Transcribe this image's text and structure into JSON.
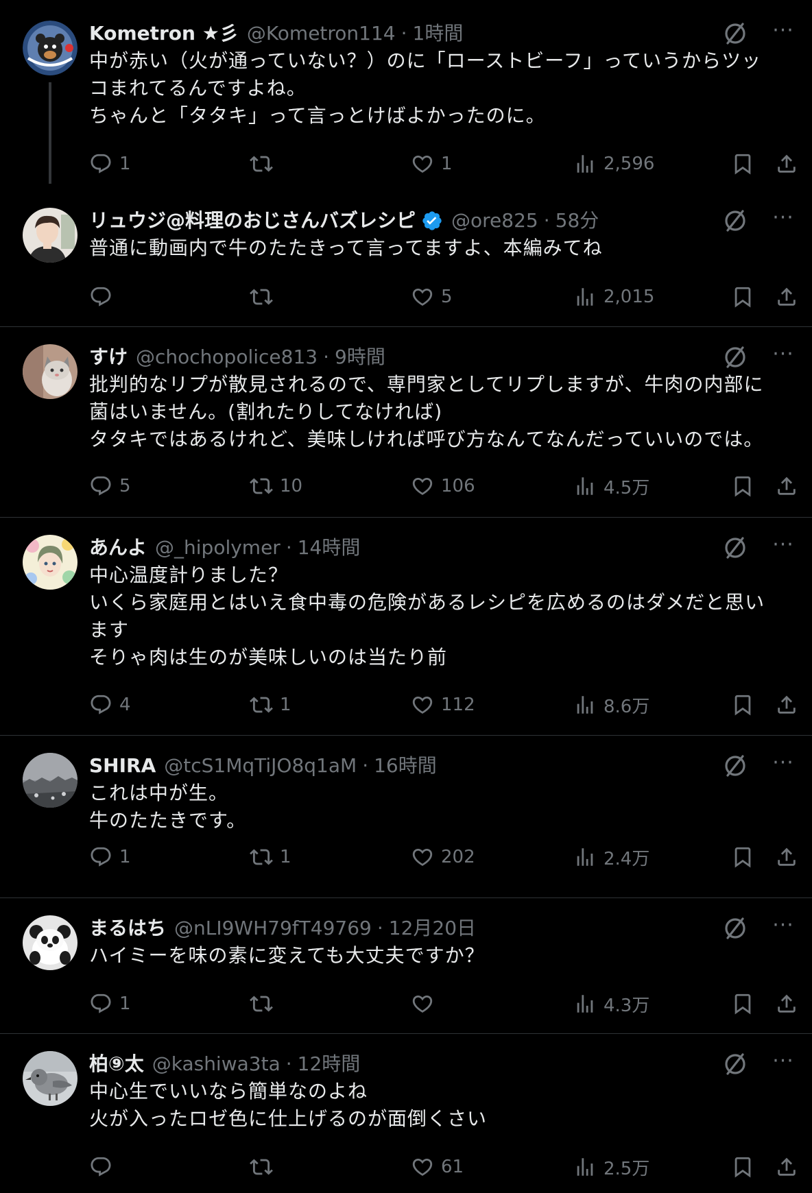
{
  "tweets": [
    {
      "name": "Kometron ★彡",
      "handle": "@Kometron114",
      "time": "1時間",
      "verified": false,
      "lines": [
        "中が赤い（火が通っていない？）のに「ローストビーフ」っていうからツッ",
        "コまれてるんですよね。",
        "ちゃんと「タタキ」って言っとけばよかったのに。"
      ],
      "replies": "1",
      "retweets": "",
      "likes": "1",
      "views": "2,596"
    },
    {
      "name": "リュウジ@料理のおじさんバズレシピ",
      "handle": "@ore825",
      "time": "58分",
      "verified": true,
      "lines": [
        "普通に動画内で牛のたたきって言ってますよ、本編みてね"
      ],
      "replies": "",
      "retweets": "",
      "likes": "5",
      "views": "2,015"
    },
    {
      "name": "すけ",
      "handle": "@chochopolice813",
      "time": "9時間",
      "verified": false,
      "lines": [
        "批判的なリプが散見されるので、専門家としてリプしますが、牛肉の内部に",
        "菌はいません。(割れたりしてなければ)",
        "タタキではあるけれど、美味しければ呼び方なんてなんだっていいのでは。"
      ],
      "replies": "5",
      "retweets": "10",
      "likes": "106",
      "views": "4.5万"
    },
    {
      "name": "あんよ",
      "handle": "@_hipolymer",
      "time": "14時間",
      "verified": false,
      "lines": [
        "中心温度計りました？",
        "いくら家庭用とはいえ食中毒の危険があるレシピを広めるのはダメだと思い",
        "ます",
        "そりゃ肉は生のが美味しいのは当たり前"
      ],
      "replies": "4",
      "retweets": "1",
      "likes": "112",
      "views": "8.6万"
    },
    {
      "name": "SHIRA",
      "handle": "@tcS1MqTiJO8q1aM",
      "time": "16時間",
      "verified": false,
      "lines": [
        "これは中が生。",
        "牛のたたきです。"
      ],
      "replies": "1",
      "retweets": "1",
      "likes": "202",
      "views": "2.4万"
    },
    {
      "name": "まるはち",
      "handle": "@nLI9WH79fT49769",
      "time": "12月20日",
      "verified": false,
      "lines": [
        "ハイミーを味の素に変えても大丈夫ですか？"
      ],
      "replies": "1",
      "retweets": "",
      "likes": "",
      "views": "4.3万"
    },
    {
      "name": "柏⑨太",
      "handle": "@kashiwa3ta",
      "time": "12時間",
      "verified": false,
      "lines": [
        "中心生でいいなら簡単なのよね",
        "火が入ったロゼ色に仕上げるのが面倒くさい"
      ],
      "replies": "",
      "retweets": "",
      "likes": "61",
      "views": "2.5万"
    }
  ],
  "ui": {
    "dot": "·",
    "more_icon": "···",
    "accent": "#1d9bf0",
    "text": "#e7e9ea",
    "muted": "#71767b",
    "border": "#2f3336",
    "background": "#000000"
  },
  "avatars": [
    "kometron-avatar",
    "ryuji-avatar",
    "suke-cat-avatar",
    "anyo-illustration-avatar",
    "shira-landscape-avatar",
    "maruhachi-panda-avatar",
    "kashiwa-bird-avatar"
  ]
}
